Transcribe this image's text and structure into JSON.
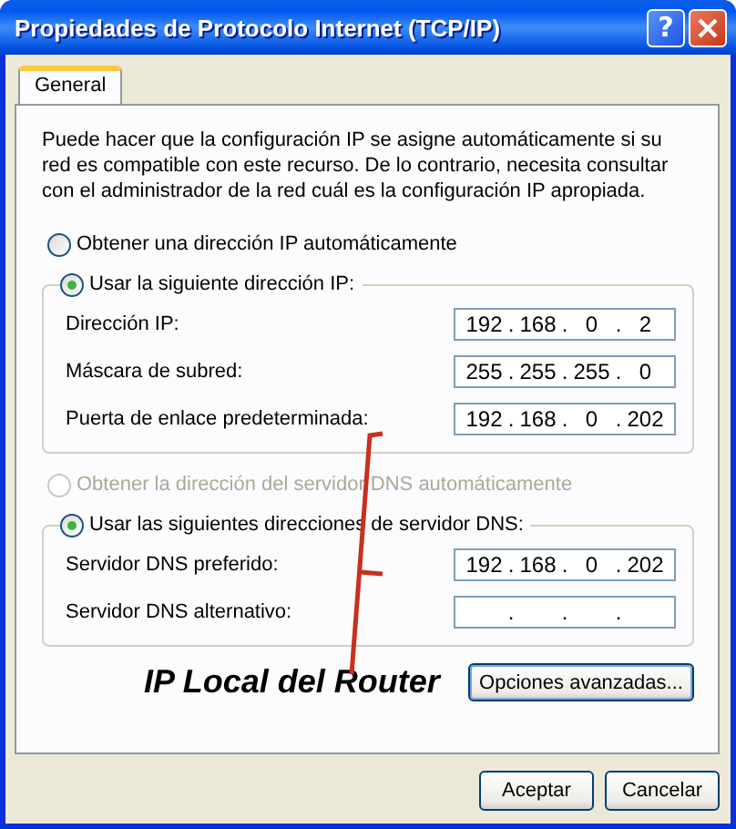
{
  "window": {
    "title": "Propiedades de Protocolo Internet (TCP/IP)",
    "help_button": "?"
  },
  "tabs": [
    {
      "label": "General",
      "selected": true
    }
  ],
  "intro": "Puede hacer que la configuración IP se asigne automáticamente si su red es compatible con este recurso. De lo contrario, necesita consultar con el administrador de la red cuál es la configuración IP apropiada.",
  "separator": ".",
  "ip_section": {
    "radios": [
      {
        "label": "Obtener una dirección IP automáticamente",
        "selected": false,
        "disabled": false
      },
      {
        "label": "Usar la siguiente dirección IP:",
        "selected": true,
        "disabled": false
      }
    ],
    "fields": [
      {
        "label": "Dirección IP:",
        "octets": [
          "192",
          "168",
          "0",
          "2"
        ]
      },
      {
        "label": "Máscara de subred:",
        "octets": [
          "255",
          "255",
          "255",
          "0"
        ]
      },
      {
        "label": "Puerta de enlace predeterminada:",
        "octets": [
          "192",
          "168",
          "0",
          "202"
        ]
      }
    ]
  },
  "dns_section": {
    "radios": [
      {
        "label": "Obtener la dirección del servidor DNS automáticamente",
        "selected": false,
        "disabled": true
      },
      {
        "label": "Usar las siguientes direcciones de servidor DNS:",
        "selected": true,
        "disabled": false
      }
    ],
    "fields": [
      {
        "label": "Servidor DNS preferido:",
        "octets": [
          "192",
          "168",
          "0",
          "202"
        ]
      },
      {
        "label": "Servidor DNS alternativo:"
      }
    ]
  },
  "annotation": {
    "text": "IP Local del Router"
  },
  "advanced_button": "Opciones avanzadas...",
  "buttons": [
    "Aceptar",
    "Cancelar"
  ]
}
